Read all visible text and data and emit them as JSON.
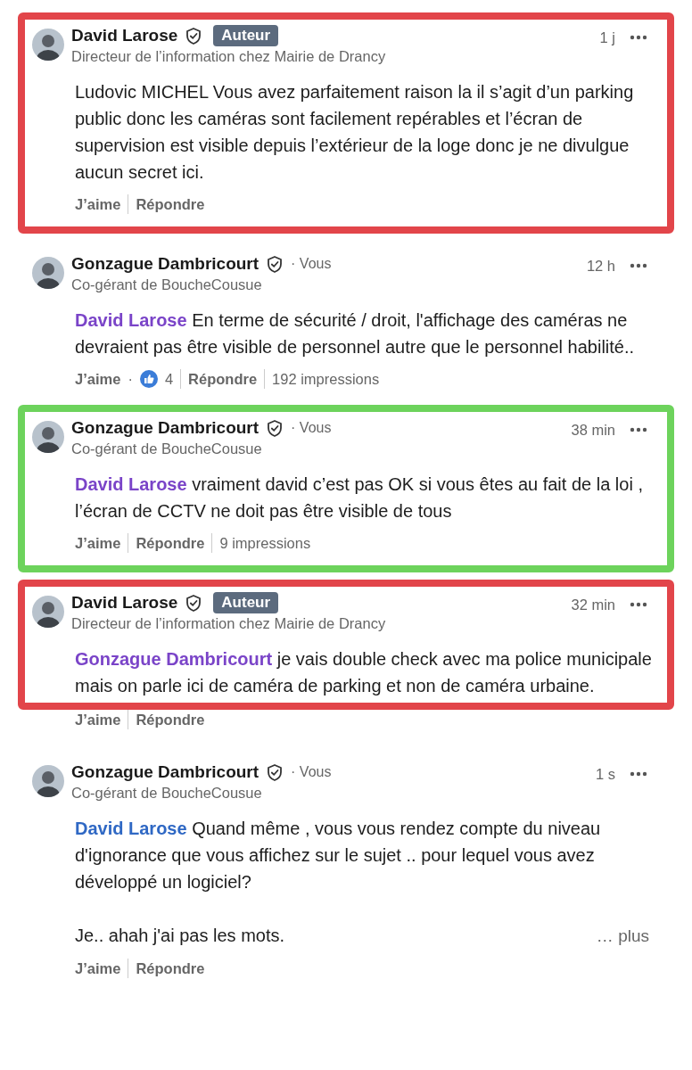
{
  "comments": [
    {
      "name": "David Larose",
      "verified": true,
      "badge": "Auteur",
      "headline": "Directeur de l’information chez Mairie de Drancy",
      "time": "1 j",
      "color": "#e2454a",
      "paragraphs": [
        {
          "text": "Ludovic MICHEL Vous avez parfaitement raison la il s’agit d’un parking public donc les caméras sont facilement repérables et l’écran de supervision est visible depuis l’extérieur de la loge donc je ne divulgue aucun secret ici."
        }
      ],
      "actions": {
        "like": "J’aime",
        "reply": "Répondre"
      }
    },
    {
      "name": "Gonzague Dambricourt",
      "verified": true,
      "you_label": "· Vous",
      "headline": "Co-gérant de BoucheCousue",
      "time": "12 h",
      "paragraphs": [
        {
          "mention": "David Larose",
          "color": "#7a44c8",
          "text": " En terme de sécurité / droit, l'affichage des caméras ne devraient pas être visible de personnel autre que le personnel habilité.."
        }
      ],
      "actions": {
        "like": "J’aime",
        "reactions": {
          "separator": "·",
          "count": "4"
        },
        "reply": "Répondre",
        "impressions": "192 impressions"
      }
    },
    {
      "name": "Gonzague Dambricourt",
      "verified": true,
      "you_label": "· Vous",
      "headline": "Co-gérant de BoucheCousue",
      "time": "38 min",
      "color": "#6dd35c",
      "paragraphs": [
        {
          "mention": "David Larose",
          "color": "#7a44c8",
          "text": " vraiment david c’est pas OK si vous êtes au fait de la loi , l’écran de CCTV ne doit pas être visible de tous"
        }
      ],
      "actions": {
        "like": "J’aime",
        "reply": "Répondre",
        "impressions": "9 impressions"
      }
    },
    {
      "name": "David Larose",
      "verified": true,
      "badge": "Auteur",
      "headline": "Directeur de l’information chez Mairie de Drancy",
      "time": "32 min",
      "color": "#e2454a",
      "paragraphs": [
        {
          "mention": "Gonzague Dambricourt",
          "color": "#7a44c8",
          "text": " je vais double check avec ma police municipale mais on parle ici de caméra de parking et non de caméra urbaine."
        }
      ],
      "actions": {
        "like": "J’aime",
        "reply": "Répondre"
      }
    },
    {
      "name": "Gonzague Dambricourt",
      "verified": true,
      "you_label": "· Vous",
      "headline": "Co-gérant de BoucheCousue",
      "time": "1 s",
      "paragraphs": [
        {
          "mention": "David Larose",
          "color": "#2f68c4",
          "text": " Quand même , vous vous rendez compte du niveau d'ignorance que vous affichez sur le sujet .. pour lequel vous avez développé un logiciel?"
        },
        {
          "text": "Je.. ahah j'ai pas les mots."
        }
      ],
      "more": "… plus",
      "actions": {
        "like": "J’aime",
        "reply": "Répondre"
      }
    }
  ]
}
